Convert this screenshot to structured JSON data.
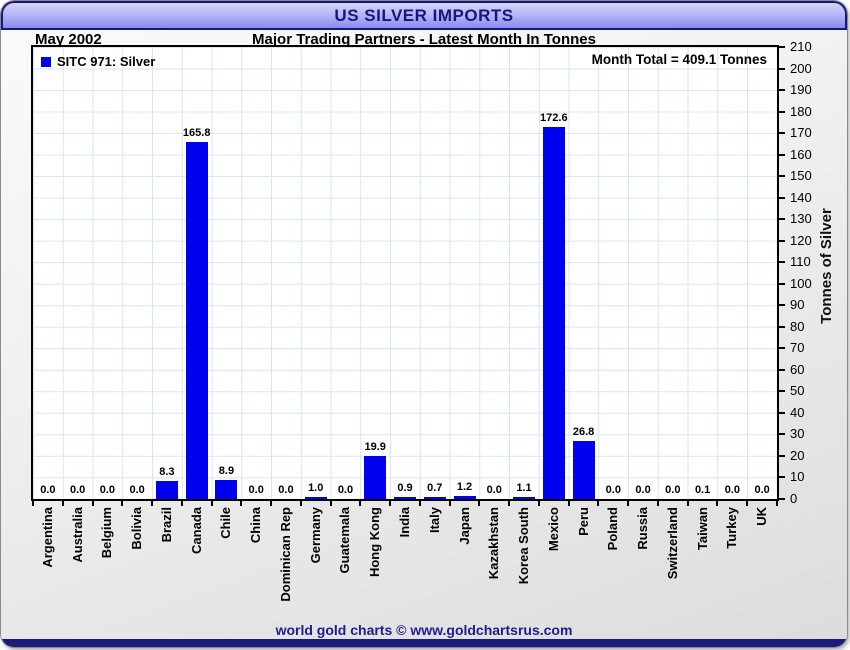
{
  "header": {
    "title": "US SILVER IMPORTS"
  },
  "subheader": {
    "period": "May 2002",
    "subtitle": "Major Trading Partners - Latest Month In Tonnes"
  },
  "legend": {
    "label": "SITC 971: Silver",
    "swatch_color": "#0000ee"
  },
  "annotation": {
    "month_total": "Month Total = 409.1 Tonnes"
  },
  "footer": {
    "text": "world gold charts © www.goldchartsrus.com"
  },
  "colors": {
    "bar": "#0000ee",
    "grid": "#d7e5f4",
    "navy": "#16167f",
    "plot_border": "#000000",
    "header_gradient_top": "#d4d4fa",
    "header_gradient_bottom": "#8a8aee"
  },
  "chart_data": {
    "type": "bar",
    "title": "US SILVER IMPORTS",
    "subtitle": "Major Trading Partners - Latest Month In Tonnes",
    "period": "May 2002",
    "categories": [
      "Argentina",
      "Australia",
      "Belgium",
      "Bolivia",
      "Brazil",
      "Canada",
      "Chile",
      "China",
      "Dominican Rep",
      "Germany",
      "Guatemala",
      "Hong Kong",
      "India",
      "Italy",
      "Japan",
      "Kazakhstan",
      "Korea South",
      "Mexico",
      "Peru",
      "Poland",
      "Russia",
      "Switzerland",
      "Taiwan",
      "Turkey",
      "UK"
    ],
    "values": [
      0.0,
      0.0,
      0.0,
      0.0,
      8.3,
      165.8,
      8.9,
      0.0,
      0.0,
      1.0,
      0.0,
      19.9,
      0.9,
      0.7,
      1.2,
      0.0,
      1.1,
      172.6,
      26.8,
      0.0,
      0.0,
      0.0,
      0.1,
      0.0,
      0.0
    ],
    "series_name": "SITC 971: Silver",
    "month_total": 409.1,
    "xlabel": "",
    "ylabel": "Tonnes of Silver",
    "ylim": [
      0,
      210
    ],
    "ytick_step": 10,
    "bar_color": "#0000ee",
    "value_labels": true,
    "grid": true,
    "legend_position": "top-left"
  }
}
